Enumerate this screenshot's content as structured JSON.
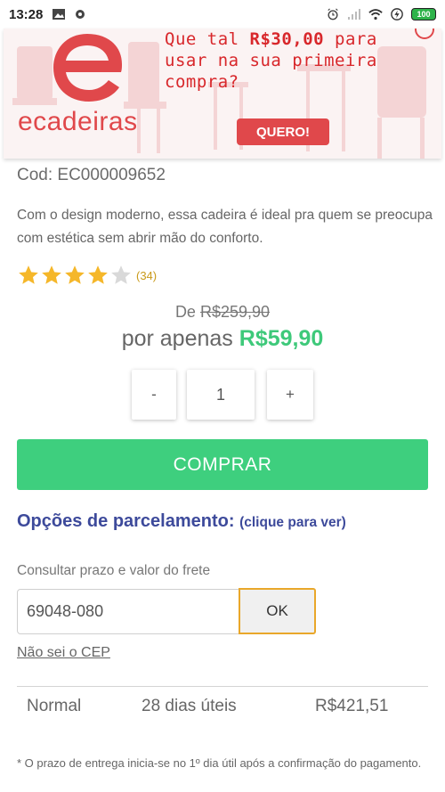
{
  "status_bar": {
    "time": "13:28",
    "battery": "100"
  },
  "banner": {
    "logo_text": "ecadeiras",
    "promo_line1_pre": "Que tal ",
    "promo_amount": "R$30,00",
    "promo_line1_post": " para",
    "promo_line2": "usar na sua primeira",
    "promo_line3": "compra?",
    "cta_label": "QUERO!",
    "brand_color": "#e0484b"
  },
  "product": {
    "code": "Cod: EC000009652",
    "description": "Com o design moderno, essa cadeira é ideal pra quem se preocupa com estética sem abrir mão do conforto.",
    "rating": 4,
    "rating_max": 5,
    "rating_count": "(34)",
    "price_from_label": "De",
    "price_old": "R$259,90",
    "price_now_label": "por apenas",
    "price_now": "R$59,90",
    "price_color": "#3ec97a"
  },
  "quantity": {
    "minus_label": "-",
    "value": "1",
    "plus_label": "+"
  },
  "buy_button": {
    "label": "COMPRAR",
    "color": "#3ecf7e"
  },
  "installments": {
    "label": "Opções de parcelamento:",
    "link": "(clique para ver)"
  },
  "shipping": {
    "label": "Consultar prazo e valor do frete",
    "cep_value": "69048-080",
    "ok_label": "OK",
    "no_cep_link": "Não sei o CEP",
    "options": [
      {
        "name": "Normal",
        "days": "28 dias úteis",
        "price": "R$421,51"
      }
    ],
    "footnote": "* O prazo de entrega inicia-se no 1º dia útil após a confirmação do pagamento."
  }
}
